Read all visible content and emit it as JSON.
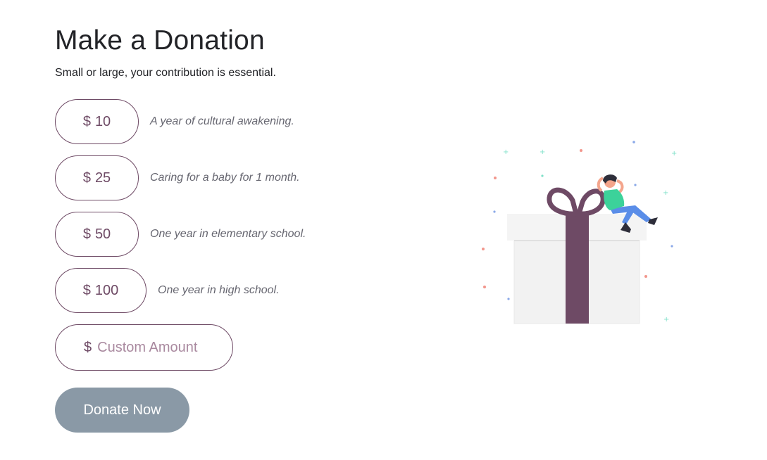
{
  "header": {
    "title": "Make a Donation",
    "subtitle": "Small or large, your contribution is essential."
  },
  "currency_symbol": "$",
  "options": [
    {
      "amount": "10",
      "description": "A year of cultural awakening."
    },
    {
      "amount": "25",
      "description": "Caring for a baby for 1 month."
    },
    {
      "amount": "50",
      "description": "One year in elementary school."
    },
    {
      "amount": "100",
      "description": "One year in high school."
    }
  ],
  "custom_amount": {
    "placeholder": "Custom Amount",
    "value": ""
  },
  "donate_button": {
    "label": "Donate Now"
  },
  "illustration": {
    "icon": "gift-box-celebration-illustration"
  },
  "colors": {
    "accent": "#6e4a65",
    "button_disabled": "#8a99a6",
    "gift_box": "#f2f2f2",
    "ribbon": "#6e4a65"
  }
}
